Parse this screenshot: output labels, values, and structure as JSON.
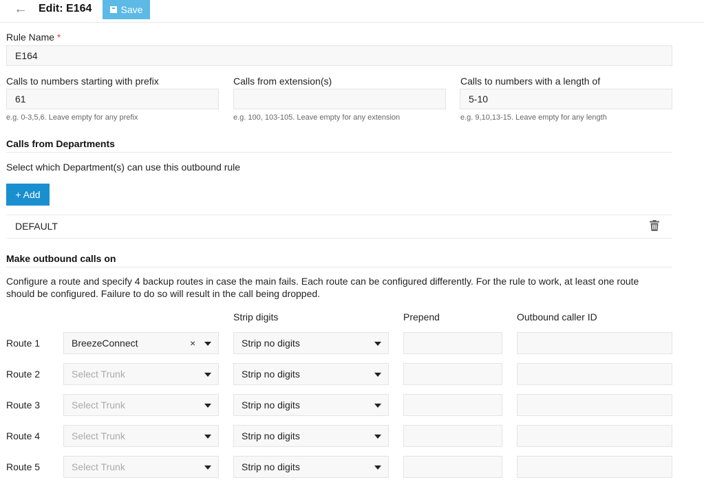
{
  "header": {
    "title": "Edit: E164",
    "save_label": "Save"
  },
  "rule_name": {
    "label": "Rule Name",
    "required_mark": "*",
    "value": "E164"
  },
  "prefix": {
    "label": "Calls to numbers starting with prefix",
    "value": "61",
    "hint": "e.g. 0-3,5,6. Leave empty for any prefix"
  },
  "extensions": {
    "label": "Calls from extension(s)",
    "value": "",
    "hint": "e.g. 100, 103-105. Leave empty for any extension"
  },
  "length": {
    "label": "Calls to numbers with a length of",
    "value": "5-10",
    "hint": "e.g. 9,10,13-15. Leave empty for any length"
  },
  "departments": {
    "heading": "Calls from Departments",
    "description": "Select which Department(s) can use this outbound rule",
    "add_label": "+ Add",
    "items": [
      "DEFAULT"
    ]
  },
  "outbound": {
    "heading": "Make outbound calls on",
    "description": "Configure a route and specify 4 backup routes in case the main fails. Each route can be configured differently. For the rule to work, at least one route should be configured. Failure to do so will result in the call being dropped.",
    "col_strip": "Strip digits",
    "col_prepend": "Prepend",
    "col_caller_id": "Outbound caller ID",
    "clear_symbol": "×",
    "routes": [
      {
        "label": "Route 1",
        "trunk": "BreezeConnect",
        "trunk_placeholder": "",
        "strip": "Strip no digits"
      },
      {
        "label": "Route 2",
        "trunk": "",
        "trunk_placeholder": "Select Trunk",
        "strip": "Strip no digits"
      },
      {
        "label": "Route 3",
        "trunk": "",
        "trunk_placeholder": "Select Trunk",
        "strip": "Strip no digits"
      },
      {
        "label": "Route 4",
        "trunk": "",
        "trunk_placeholder": "Select Trunk",
        "strip": "Strip no digits"
      },
      {
        "label": "Route 5",
        "trunk": "",
        "trunk_placeholder": "Select Trunk",
        "strip": "Strip no digits"
      }
    ]
  },
  "icons": {
    "back": "arrow-left-icon",
    "save": "floppy-icon",
    "delete": "trash-icon",
    "dropdown": "caret-down-icon"
  },
  "colors": {
    "save_button": "#5db9e6",
    "add_button": "#1a8fd0",
    "required": "#ee4444"
  }
}
